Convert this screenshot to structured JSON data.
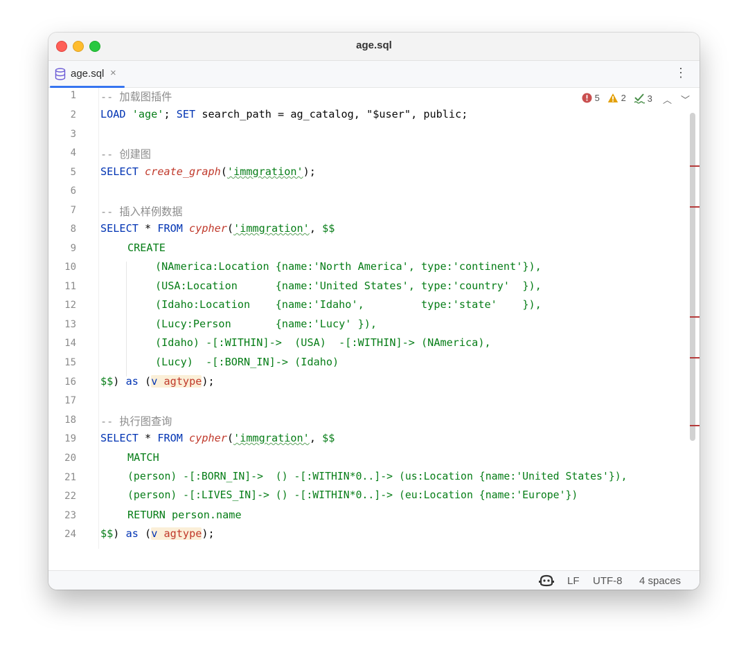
{
  "window": {
    "title": "age.sql"
  },
  "tab": {
    "label": "age.sql",
    "close": "×"
  },
  "menu": {
    "kebab": "⋮"
  },
  "inspections": {
    "errors": "5",
    "warnings": "2",
    "typos": "3"
  },
  "status": {
    "line_separator": "LF",
    "encoding": "UTF-8",
    "indent": "4 spaces"
  },
  "code": {
    "l1": {
      "no": "1",
      "comment": "-- 加载图插件"
    },
    "l2": {
      "no": "2",
      "kw1": "LOAD",
      "str1": "'age'",
      "p1": "; ",
      "kw2": "SET",
      "p2": " search_path = ag_catalog, \"$user\", public;"
    },
    "l3": {
      "no": "3"
    },
    "l4": {
      "no": "4",
      "comment": "-- 创建图"
    },
    "l5": {
      "no": "5",
      "kw1": "SELECT",
      "fn": "create_graph",
      "p1": "(",
      "str1": "'immgration'",
      "p2": ");"
    },
    "l6": {
      "no": "6"
    },
    "l7": {
      "no": "7",
      "comment": "-- 插入样例数据"
    },
    "l8": {
      "no": "8",
      "kw1": "SELECT",
      "p1": " * ",
      "kw2": "FROM",
      "fn": "cypher",
      "p2": "(",
      "str1": "'immgration'",
      "p3": ", ",
      "str2": "$$"
    },
    "l9": {
      "no": "9",
      "body": "CREATE"
    },
    "l10": {
      "no": "10",
      "body": "(NAmerica:Location {name:'North America', type:'continent'}),"
    },
    "l11": {
      "no": "11",
      "body": "(USA:Location      {name:'United States', type:'country'  }),"
    },
    "l12": {
      "no": "12",
      "body": "(Idaho:Location    {name:'Idaho',         type:'state'    }),"
    },
    "l13": {
      "no": "13",
      "body": "(Lucy:Person       {name:'Lucy' }),"
    },
    "l14": {
      "no": "14",
      "body": "(Idaho) -[:WITHIN]->  (USA)  -[:WITHIN]-> (NAmerica),"
    },
    "l15": {
      "no": "15",
      "body": "(Lucy)  -[:BORN_IN]-> (Idaho)"
    },
    "l16": {
      "no": "16",
      "str1": "$$",
      "p1": ") ",
      "kw1": "as",
      "p2": " (",
      "v": "v",
      "typ": "agtype",
      "p3": ");"
    },
    "l17": {
      "no": "17"
    },
    "l18": {
      "no": "18",
      "comment": "-- 执行图查询"
    },
    "l19": {
      "no": "19",
      "kw1": "SELECT",
      "p1": " * ",
      "kw2": "FROM",
      "fn": "cypher",
      "p2": "(",
      "str1": "'immgration'",
      "p3": ", ",
      "str2": "$$"
    },
    "l20": {
      "no": "20",
      "body": "MATCH"
    },
    "l21": {
      "no": "21",
      "body": "(person) -[:BORN_IN]->  () -[:WITHIN*0..]-> (us:Location {name:'United States'}),"
    },
    "l22": {
      "no": "22",
      "body": "(person) -[:LIVES_IN]-> () -[:WITHIN*0..]-> (eu:Location {name:'Europe'})"
    },
    "l23": {
      "no": "23",
      "body": "RETURN person.name"
    },
    "l24": {
      "no": "24",
      "str1": "$$",
      "p1": ") ",
      "kw1": "as",
      "p2": " (",
      "v": "v",
      "typ": "agtype",
      "p3": ");"
    }
  },
  "colors": {
    "keyword": "#0033b3",
    "comment": "#8c8c8c",
    "string": "#067d17",
    "function": "#c0392b",
    "accent": "#3574f0",
    "error": "#c94f4f",
    "warning": "#e3a008"
  }
}
